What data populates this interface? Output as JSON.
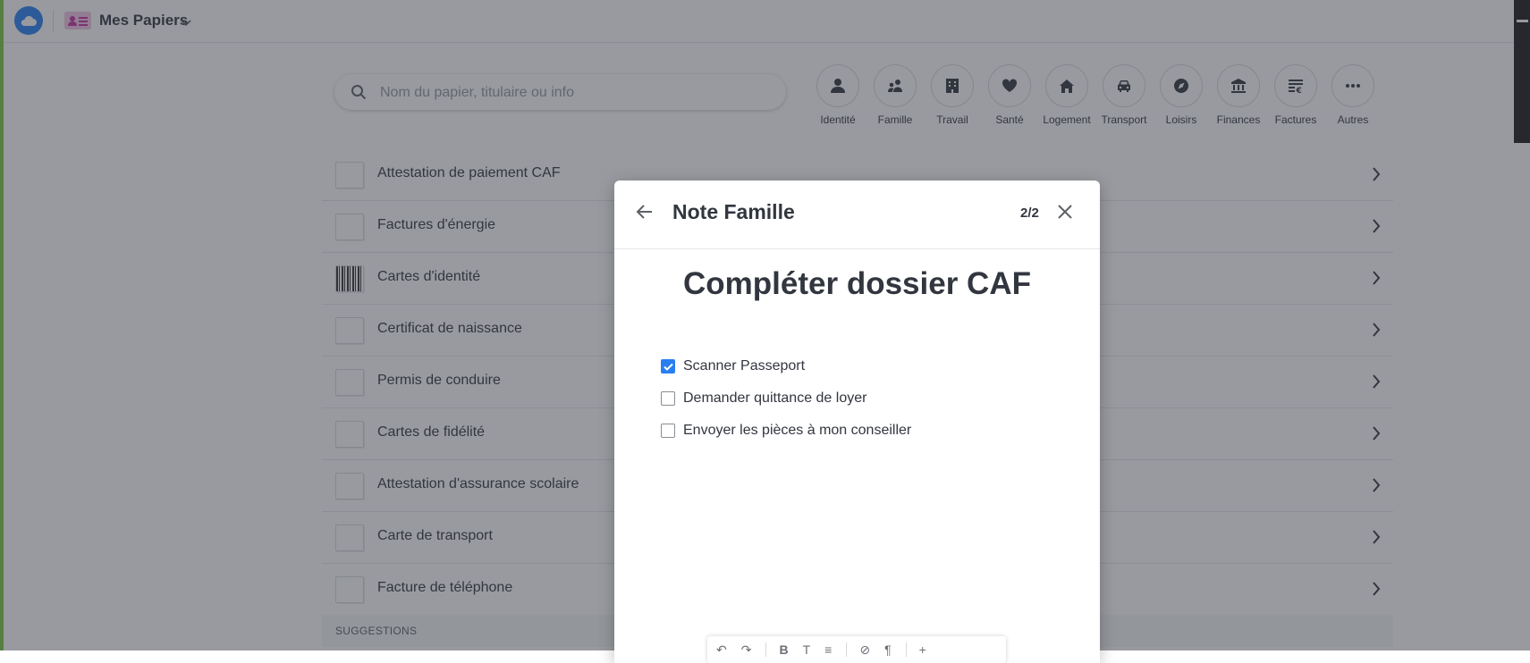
{
  "app": {
    "title": "Mes Papiers"
  },
  "search": {
    "placeholder": "Nom du papier, titulaire ou info"
  },
  "categories": [
    {
      "label": "Identité",
      "icon": "person-icon"
    },
    {
      "label": "Famille",
      "icon": "family-icon"
    },
    {
      "label": "Travail",
      "icon": "building-icon"
    },
    {
      "label": "Santé",
      "icon": "heart-icon"
    },
    {
      "label": "Logement",
      "icon": "home-icon"
    },
    {
      "label": "Transport",
      "icon": "car-icon"
    },
    {
      "label": "Loisirs",
      "icon": "compass-icon"
    },
    {
      "label": "Finances",
      "icon": "bank-icon"
    },
    {
      "label": "Factures",
      "icon": "bill-icon"
    },
    {
      "label": "Autres",
      "icon": "more-icon"
    }
  ],
  "papers": [
    {
      "label": "Attestation de paiement CAF"
    },
    {
      "label": "Factures d'énergie"
    },
    {
      "label": "Cartes d'identité"
    },
    {
      "label": "Certificat de naissance"
    },
    {
      "label": "Permis de conduire"
    },
    {
      "label": "Cartes de fidélité"
    },
    {
      "label": "Attestation d'assurance scolaire"
    },
    {
      "label": "Carte de transport"
    },
    {
      "label": "Facture de téléphone"
    }
  ],
  "suggestions_header": "SUGGESTIONS",
  "modal": {
    "title": "Note Famille",
    "pager": "2/2",
    "note_title": "Compléter dossier CAF",
    "todos": [
      {
        "text": "Scanner Passeport",
        "checked": true
      },
      {
        "text": "Demander quittance de loyer",
        "checked": false
      },
      {
        "text": "Envoyer les pièces à mon conseiller",
        "checked": false
      }
    ]
  },
  "colors": {
    "accent": "#297ef2",
    "app_icon_bg": "#f3c4e6",
    "side_strip": "#7ac843"
  }
}
